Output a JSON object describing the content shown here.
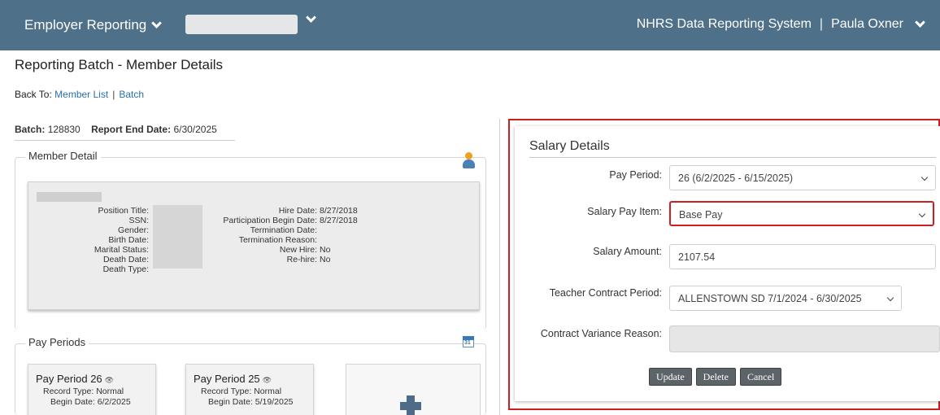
{
  "topbar": {
    "menu_label": "Employer Reporting",
    "system_name": "NHRS Data Reporting System",
    "separator": "|",
    "user_name": "Paula Oxner"
  },
  "page": {
    "title": "Reporting Batch - Member Details",
    "back_to_label": "Back To:",
    "back_links": [
      "Member List",
      "Batch"
    ],
    "back_separator": "|"
  },
  "batch": {
    "batch_label": "Batch:",
    "batch_value": "128830",
    "report_end_label": "Report End Date:",
    "report_end_value": "6/30/2025"
  },
  "member_detail": {
    "legend": "Member Detail",
    "left_fields": [
      {
        "label": "Position Title:",
        "value": ""
      },
      {
        "label": "SSN:",
        "value": ""
      },
      {
        "label": "Gender:",
        "value": ""
      },
      {
        "label": "Birth Date:",
        "value": ""
      },
      {
        "label": "Marital Status:",
        "value": ""
      },
      {
        "label": "Death Date:",
        "value": ""
      },
      {
        "label": "Death Type:",
        "value": ""
      }
    ],
    "right_fields": [
      {
        "label": "Hire Date:",
        "value": "8/27/2018"
      },
      {
        "label": "Participation Begin Date:",
        "value": "8/27/2018"
      },
      {
        "label": "Termination Date:",
        "value": ""
      },
      {
        "label": "Termination Reason:",
        "value": ""
      },
      {
        "label": "New Hire:",
        "value": "No"
      },
      {
        "label": "Re-hire:",
        "value": "No"
      }
    ]
  },
  "pay_periods": {
    "legend": "Pay Periods",
    "calendar_number": "31",
    "cards": [
      {
        "title": "Pay Period 26",
        "record_type_label": "Record Type:",
        "record_type": "Normal",
        "begin_label": "Begin Date:",
        "begin_date": "6/2/2025"
      },
      {
        "title": "Pay Period 25",
        "record_type_label": "Record Type:",
        "record_type": "Normal",
        "begin_label": "Begin Date:",
        "begin_date": "5/19/2025"
      }
    ]
  },
  "salary": {
    "title": "Salary Details",
    "pay_period_label": "Pay Period:",
    "pay_period_value": "26 (6/2/2025 - 6/15/2025)",
    "pay_item_label": "Salary Pay Item:",
    "pay_item_value": "Base Pay",
    "amount_label": "Salary Amount:",
    "amount_value": "2107.54",
    "contract_label": "Teacher Contract Period:",
    "contract_value": "ALLENSTOWN SD 7/1/2024 - 6/30/2025",
    "variance_label": "Contract Variance Reason:",
    "variance_value": "",
    "buttons": {
      "update": "Update",
      "delete": "Delete",
      "cancel": "Cancel"
    }
  },
  "colors": {
    "topbar": "#4e7088",
    "highlight": "#cc1f1f",
    "link": "#2a6fb0",
    "button": "#5d6468"
  },
  "icons": [
    "chevron-down-icon",
    "member-person-icon",
    "calendar-icon",
    "eye-icon",
    "plus-icon"
  ]
}
